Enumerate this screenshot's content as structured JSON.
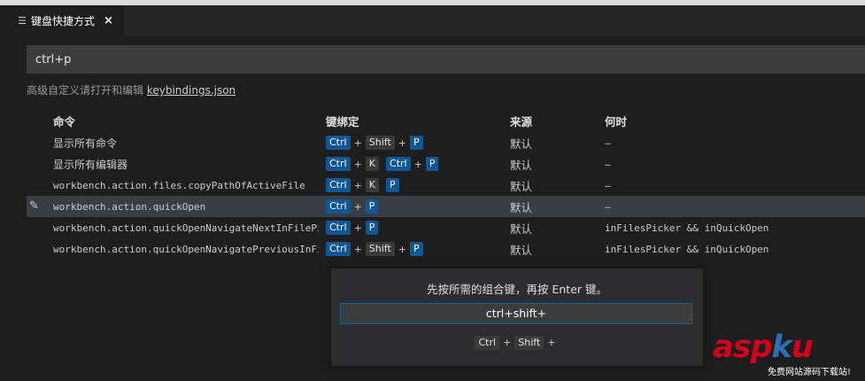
{
  "tab": {
    "icon": "list-icon",
    "title": "键盘快捷方式",
    "close": "×"
  },
  "search": {
    "value": "ctrl+p"
  },
  "hint": {
    "text": "高级自定义请打开和编辑 ",
    "link": "keybindings.json"
  },
  "columns": {
    "command": "命令",
    "keybinding": "键绑定",
    "source": "来源",
    "when": "何时"
  },
  "rows": [
    {
      "command": "显示所有命令",
      "mono": false,
      "keys": [
        [
          "Ctrl",
          "blue"
        ],
        [
          "Shift",
          "gray"
        ],
        [
          "P",
          "blue"
        ]
      ],
      "seps": [
        "+",
        "+"
      ],
      "source": "默认",
      "when": "—"
    },
    {
      "command": "显示所有编辑器",
      "mono": false,
      "keys": [
        [
          "Ctrl",
          "blue"
        ],
        [
          "K",
          "gray"
        ],
        [
          "Ctrl",
          "blue"
        ],
        [
          "P",
          "blue"
        ]
      ],
      "seps": [
        "+",
        "",
        "+"
      ],
      "source": "默认",
      "when": "—"
    },
    {
      "command": "workbench.action.files.copyPathOfActiveFile",
      "mono": true,
      "keys": [
        [
          "Ctrl",
          "blue"
        ],
        [
          "K",
          "gray"
        ],
        [
          "P",
          "blue"
        ]
      ],
      "seps": [
        "+",
        ""
      ],
      "source": "默认",
      "when": "—"
    },
    {
      "command": "workbench.action.quickOpen",
      "mono": true,
      "selected": true,
      "keys": [
        [
          "Ctrl",
          "blue"
        ],
        [
          "P",
          "blue"
        ]
      ],
      "seps": [
        "+"
      ],
      "source": "默认",
      "when": "—"
    },
    {
      "command": "workbench.action.quickOpenNavigateNextInFilePi…",
      "mono": true,
      "keys": [
        [
          "Ctrl",
          "blue"
        ],
        [
          "P",
          "blue"
        ]
      ],
      "seps": [
        "+"
      ],
      "source": "默认",
      "when": "inFilesPicker && inQuickOpen"
    },
    {
      "command": "workbench.action.quickOpenNavigatePreviousInFi…",
      "mono": true,
      "keys": [
        [
          "Ctrl",
          "blue"
        ],
        [
          "Shift",
          "gray"
        ],
        [
          "P",
          "blue"
        ]
      ],
      "seps": [
        "+",
        "+"
      ],
      "source": "默认",
      "when": "inFilesPicker && inQuickOpen"
    }
  ],
  "widget": {
    "message": "先按所需的组合键，再按 Enter 键。",
    "input": "ctrl+shift+",
    "keys": [
      "Ctrl",
      "Shift"
    ],
    "trailing": "+"
  },
  "watermark": {
    "main_a": "asp",
    "main_b": "k",
    "main_c": "u",
    "dotcom": ".com",
    "sub": "免费网站源码下载站!"
  }
}
